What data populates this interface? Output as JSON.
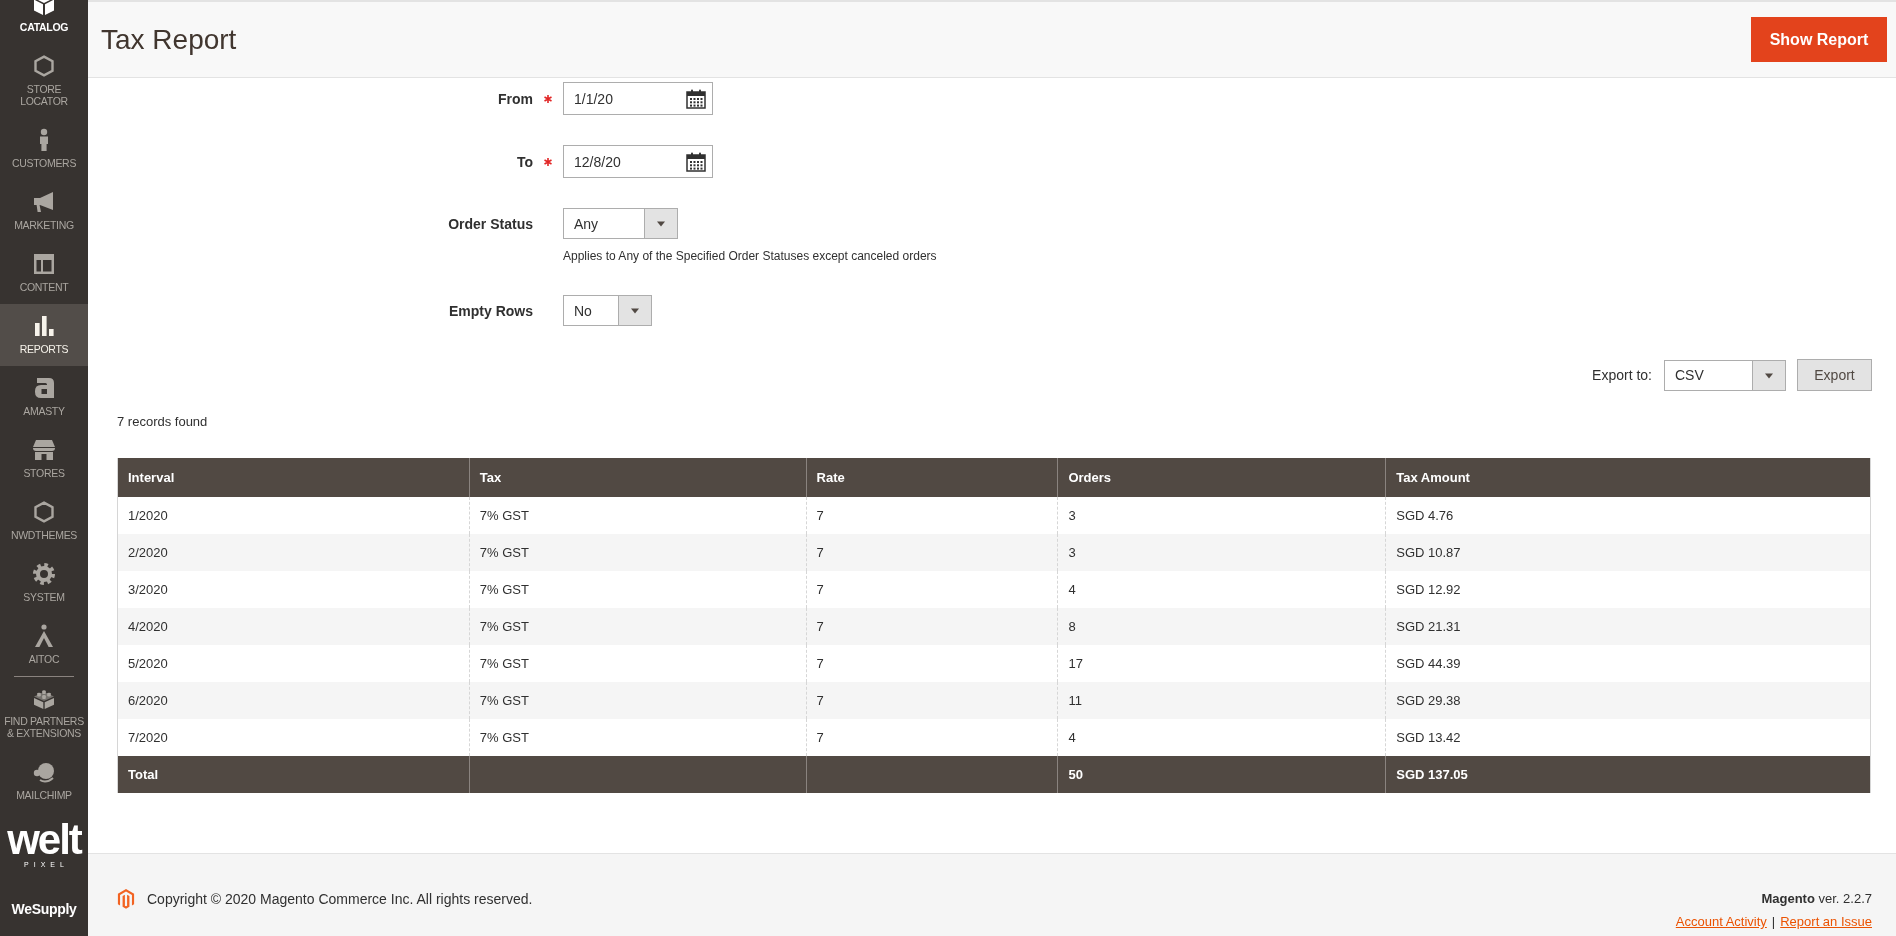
{
  "sidebar": {
    "items": [
      {
        "label": "CATALOG",
        "selected": false,
        "highlighted": true,
        "divider_above": false
      },
      {
        "label": "STORE\nLOCATOR",
        "selected": false,
        "highlighted": false,
        "divider_above": false
      },
      {
        "label": "CUSTOMERS",
        "selected": false,
        "highlighted": false,
        "divider_above": false
      },
      {
        "label": "MARKETING",
        "selected": false,
        "highlighted": false,
        "divider_above": false
      },
      {
        "label": "CONTENT",
        "selected": false,
        "highlighted": false,
        "divider_above": false
      },
      {
        "label": "REPORTS",
        "selected": true,
        "highlighted": false,
        "divider_above": false
      },
      {
        "label": "AMASTY",
        "selected": false,
        "highlighted": false,
        "divider_above": false
      },
      {
        "label": "STORES",
        "selected": false,
        "highlighted": false,
        "divider_above": false
      },
      {
        "label": "NWDTHEMES",
        "selected": false,
        "highlighted": false,
        "divider_above": false
      },
      {
        "label": "SYSTEM",
        "selected": false,
        "highlighted": false,
        "divider_above": false
      },
      {
        "label": "AITOC",
        "selected": false,
        "highlighted": false,
        "divider_above": false
      },
      {
        "label": "FIND PARTNERS\n& EXTENSIONS",
        "selected": false,
        "highlighted": false,
        "divider_above": true
      },
      {
        "label": "MAILCHIMP",
        "selected": false,
        "highlighted": false,
        "divider_above": false
      }
    ],
    "logo": {
      "text": "welt",
      "subtext": "PIXEL"
    },
    "bottom_item": "WeSupply"
  },
  "header": {
    "title": "Tax Report",
    "button": "Show Report"
  },
  "filters": [
    {
      "kind": "date",
      "label": "From",
      "required": true,
      "value": "1/1/20"
    },
    {
      "kind": "date",
      "label": "To",
      "required": true,
      "value": "12/8/20"
    },
    {
      "kind": "select",
      "label": "Order Status",
      "required": false,
      "value": "Any",
      "note": "Applies to Any of the Specified Order Statuses except canceled orders"
    },
    {
      "kind": "select",
      "label": "Empty Rows",
      "required": false,
      "value": "No"
    }
  ],
  "export": {
    "label": "Export to:",
    "value": "CSV",
    "button": "Export"
  },
  "records_found": "7 records found",
  "table": {
    "columns": [
      "Interval",
      "Tax",
      "Rate",
      "Orders",
      "Tax Amount"
    ],
    "rows": [
      [
        "1/2020",
        "7% GST",
        "7",
        "3",
        "SGD 4.76"
      ],
      [
        "2/2020",
        "7% GST",
        "7",
        "3",
        "SGD 10.87"
      ],
      [
        "3/2020",
        "7% GST",
        "7",
        "4",
        "SGD 12.92"
      ],
      [
        "4/2020",
        "7% GST",
        "7",
        "8",
        "SGD 21.31"
      ],
      [
        "5/2020",
        "7% GST",
        "7",
        "17",
        "SGD 44.39"
      ],
      [
        "6/2020",
        "7% GST",
        "7",
        "11",
        "SGD 29.38"
      ],
      [
        "7/2020",
        "7% GST",
        "7",
        "4",
        "SGD 13.42"
      ]
    ],
    "totals": {
      "label": "Total",
      "orders": "50",
      "tax_amount": "SGD 137.05"
    }
  },
  "footer": {
    "copyright": "Copyright © 2020 Magento Commerce Inc. All rights reserved.",
    "version": "**Magento** ver. 2.2.7",
    "links": [
      "Account Activity",
      "Report an Issue"
    ],
    "link_separator": "|"
  }
}
